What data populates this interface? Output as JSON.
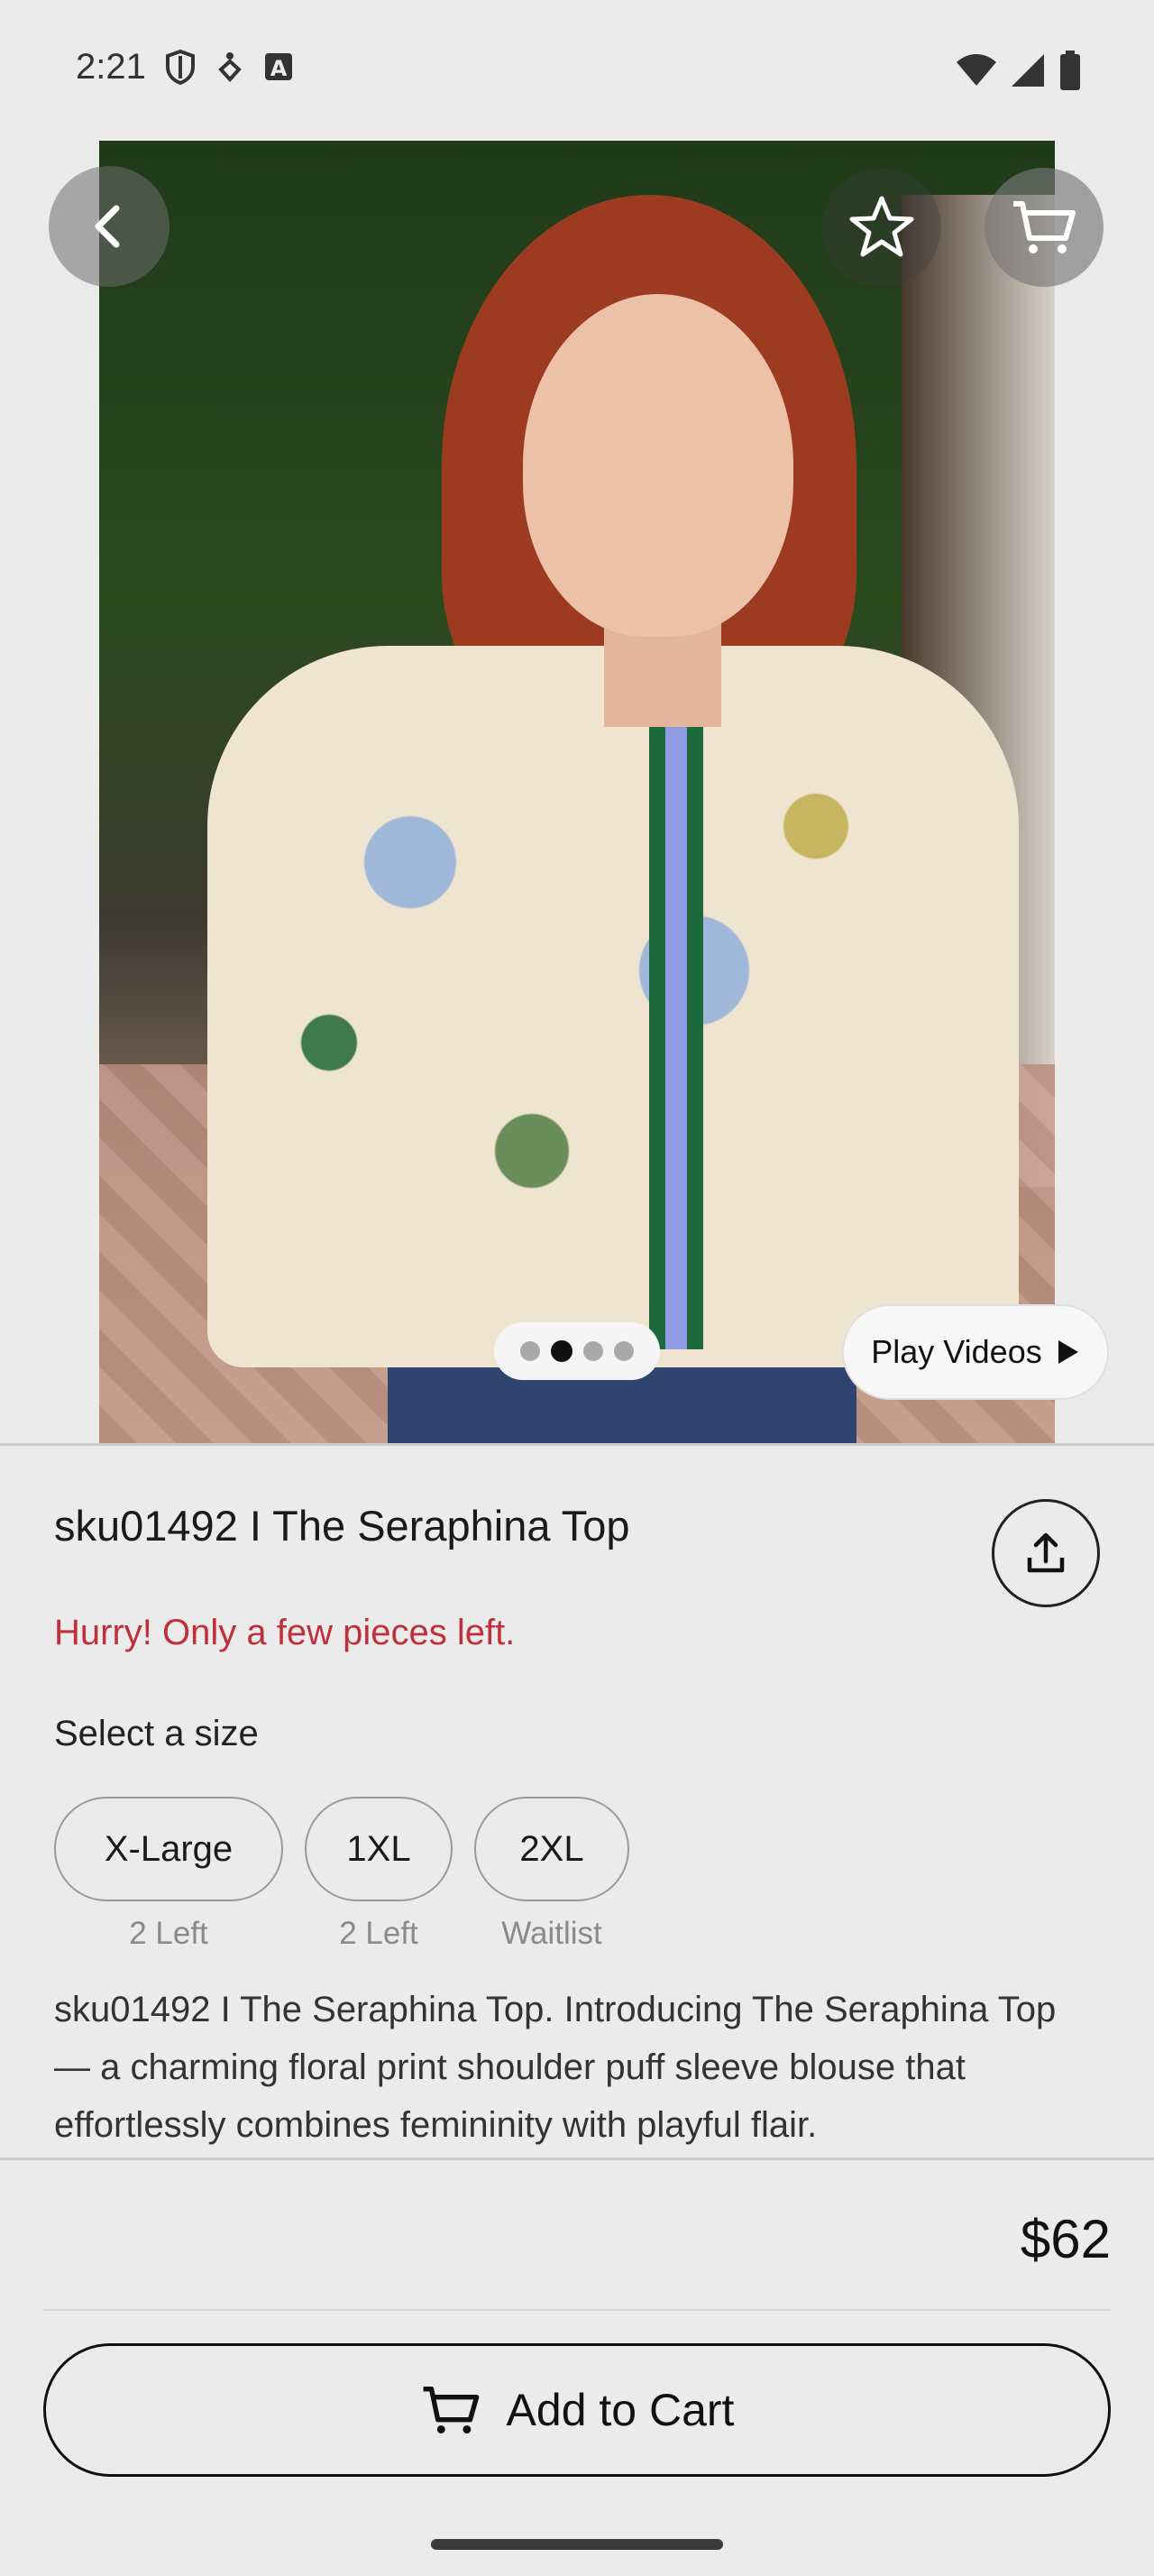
{
  "status_bar": {
    "time": "2:21",
    "left_icons": [
      "shield-icon",
      "accessibility-icon",
      "keyboard-a-icon"
    ],
    "right_icons": [
      "wifi-icon",
      "cell-signal-icon",
      "battery-icon"
    ]
  },
  "gallery": {
    "image_count": 4,
    "active_index": 1,
    "play_videos_label": "Play Videos"
  },
  "product": {
    "title": "sku01492 I The Seraphina Top",
    "stock_warning": "Hurry! Only a few pieces left.",
    "select_size_label": "Select a size",
    "sizes": [
      {
        "label": "X-Large",
        "availability": "2 Left"
      },
      {
        "label": "1XL",
        "availability": "2 Left"
      },
      {
        "label": "2XL",
        "availability": "Waitlist"
      }
    ],
    "description": "sku01492 I The Seraphina Top. Introducing The Seraphina Top — a charming floral print shoulder puff sleeve blouse that effortlessly combines femininity with playful flair.",
    "price": "$62"
  },
  "actions": {
    "add_to_cart_label": "Add to Cart"
  },
  "colors": {
    "warning": "#c0303a",
    "background": "#ebebeb"
  }
}
